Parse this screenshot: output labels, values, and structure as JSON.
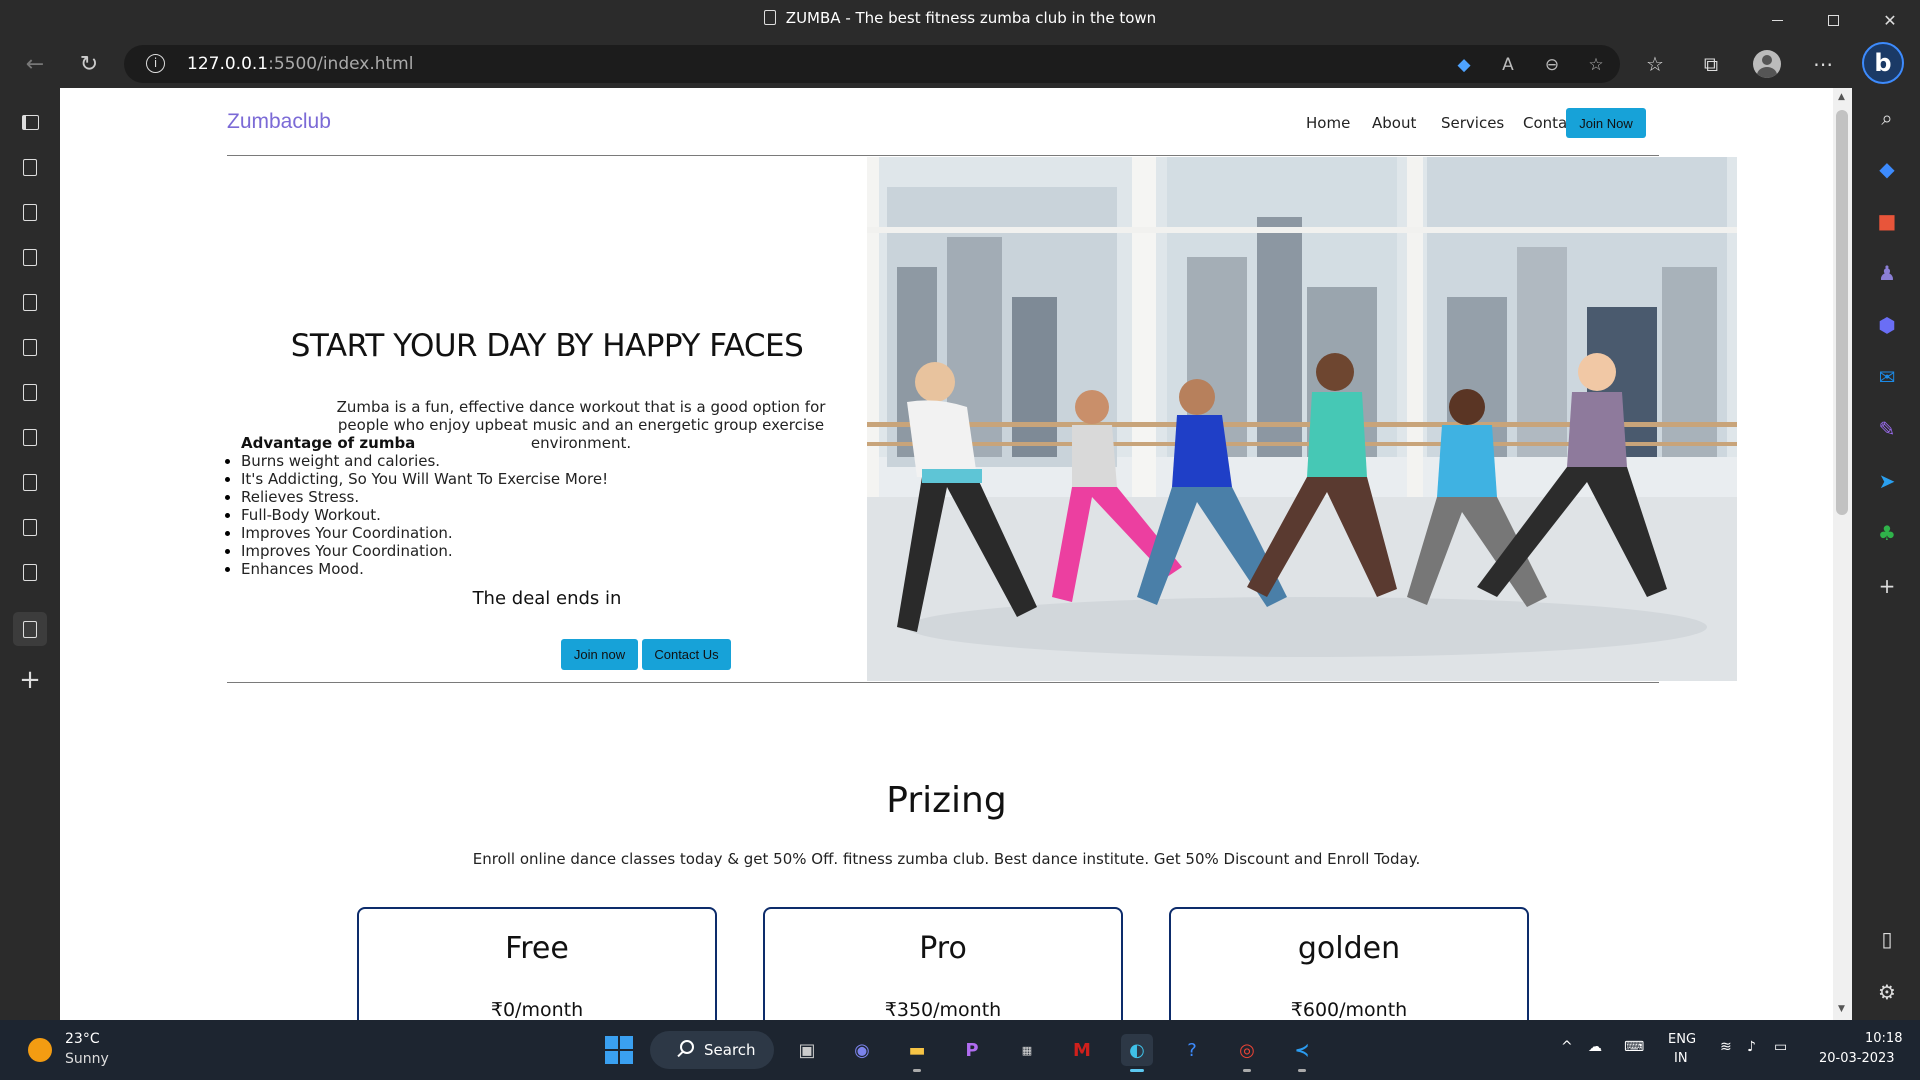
{
  "browser": {
    "tab_title": "ZUMBA - The best fitness zumba club in the town",
    "url_host": "127.0.0.1",
    "url_path": ":5500/index.html"
  },
  "site": {
    "logo": "Zumbaclub",
    "nav": [
      "Home",
      "About",
      "Services",
      "Contact Us"
    ],
    "join_button": "Join Now"
  },
  "hero": {
    "title": "START YOUR DAY BY HAPPY FACES",
    "description": "Zumba is a fun, effective dance workout that is a good option for people who enjoy upbeat music and an energetic group exercise environment.",
    "advantage_title": "Advantage of zumba",
    "advantages": [
      "Burns weight and calories.",
      "It's Addicting, So You Will Want To Exercise More!",
      "Relieves Stress.",
      "Full-Body Workout.",
      "Improves Your Coordination.",
      "Improves Your Coordination.",
      "Enhances Mood."
    ],
    "deal_text": "The deal ends in",
    "join_now": "Join now",
    "contact_us": "Contact Us"
  },
  "pricing": {
    "title": "Prizing",
    "subtitle": "Enroll online dance classes today & get 50% Off. fitness zumba club. Best dance institute. Get 50% Discount and Enroll Today.",
    "plans": [
      {
        "name": "Free",
        "price": "₹0/month"
      },
      {
        "name": "Pro",
        "price": "₹350/month"
      },
      {
        "name": "golden",
        "price": "₹600/month"
      }
    ]
  },
  "taskbar": {
    "temperature": "23°C",
    "condition": "Sunny",
    "search_label": "Search",
    "lang_top": "ENG",
    "lang_bottom": "IN",
    "time": "10:18",
    "date": "20-03-2023"
  },
  "colors": {
    "accent_button": "#17a2d8",
    "logo": "#7b6ad6",
    "plan_border": "#0d2c6b"
  }
}
